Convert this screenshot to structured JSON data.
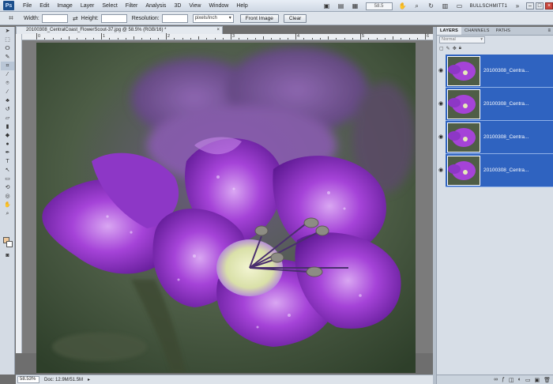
{
  "app": {
    "logo": "Ps",
    "menu": [
      "File",
      "Edit",
      "Image",
      "Layer",
      "Select",
      "Filter",
      "Analysis",
      "3D",
      "View",
      "Window",
      "Help"
    ],
    "zoom_value": "58.5",
    "workspace": "BULLSCHMITT1"
  },
  "options": {
    "width_label": "Width:",
    "height_label": "Height:",
    "resolution_label": "Resolution:",
    "units": "pixels/inch",
    "front_image_label": "Front Image",
    "clear_label": "Clear"
  },
  "document": {
    "tab_title": "20100308_CentralCoast_FlowerScout-37.jpg @ 58.5% (RGB/16) *",
    "ruler_numbers": [
      "0",
      "1",
      "2",
      "3",
      "4",
      "5",
      "6"
    ],
    "status_zoom": "58.53%",
    "status_doc": "Doc: 12.9M/51.5M"
  },
  "panel": {
    "tabs": [
      "LAYERS",
      "CHANNELS",
      "PATHS"
    ],
    "blend_mode": "Normal",
    "layers": [
      {
        "name": "20100308_Centra..."
      },
      {
        "name": "20100308_Centra..."
      },
      {
        "name": "20100308_Centra..."
      },
      {
        "name": "20100308_Centra..."
      }
    ]
  },
  "colors": {
    "selected_layer": "#2f63c0",
    "foreground": "#efc89a",
    "background": "#ffffff"
  }
}
